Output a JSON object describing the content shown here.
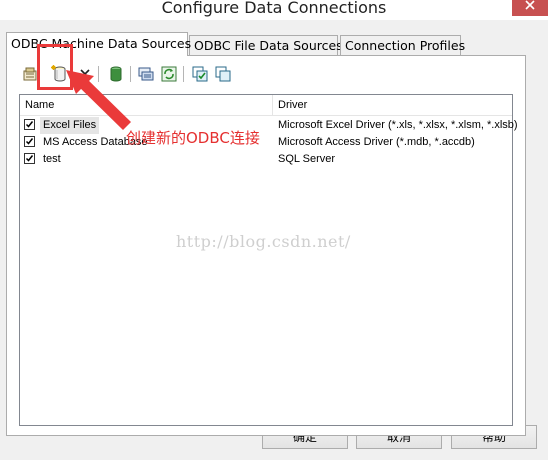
{
  "window": {
    "title": "Configure Data Connections",
    "close_glyph": "x"
  },
  "tabs": [
    {
      "label": "ODBC Machine Data Sources",
      "active": true
    },
    {
      "label": "ODBC File Data Sources",
      "active": false
    },
    {
      "label": "Connection Profiles",
      "active": false
    }
  ],
  "toolbar": {
    "buttons": [
      {
        "name": "properties-icon"
      },
      {
        "name": "new-data-source-icon"
      },
      {
        "name": "delete-icon"
      },
      {
        "name": "test-connection-icon"
      },
      {
        "name": "configure-icon"
      },
      {
        "name": "refresh-icon"
      },
      {
        "name": "select-all-icon"
      },
      {
        "name": "deselect-all-icon"
      }
    ]
  },
  "list": {
    "columns": {
      "name": "Name",
      "driver": "Driver"
    },
    "rows": [
      {
        "name": "Excel Files",
        "driver": "Microsoft Excel Driver (*.xls, *.xlsx, *.xlsm, *.xlsb)",
        "checked": true
      },
      {
        "name": "MS Access Database",
        "driver": "Microsoft Access Driver (*.mdb, *.accdb)",
        "checked": true
      },
      {
        "name": "test",
        "driver": "SQL Server",
        "checked": true
      }
    ]
  },
  "annotation": {
    "text": "创建新的ODBC连接",
    "color": "#e53030"
  },
  "watermark": "http://blog.csdn.net/",
  "buttons": {
    "ok": "确定",
    "cancel": "取消",
    "help": "帮助"
  }
}
